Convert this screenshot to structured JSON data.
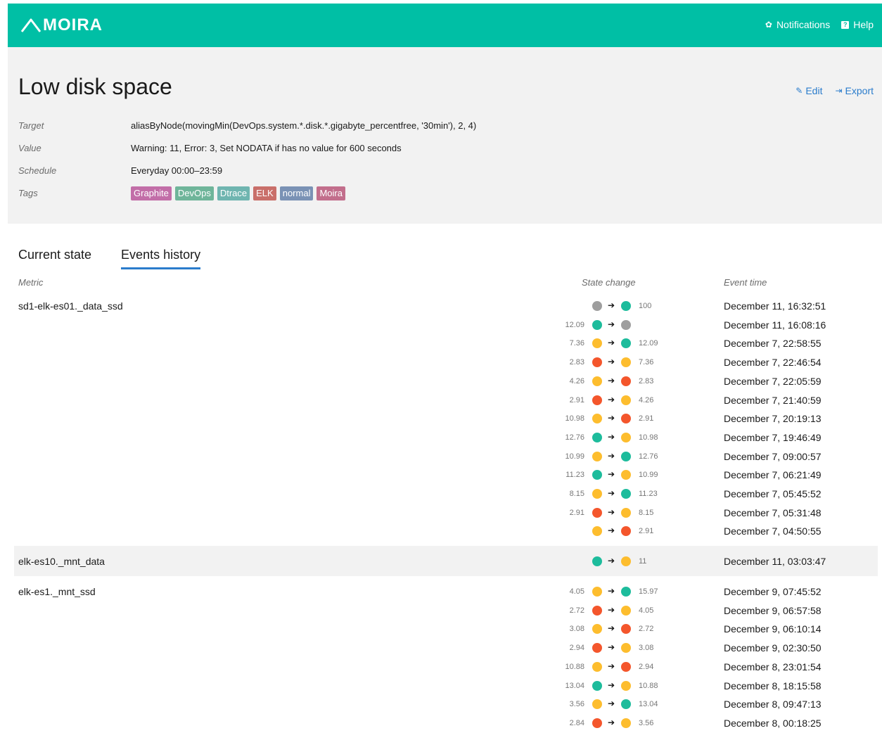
{
  "header": {
    "logo": "MOIRA",
    "nav": [
      {
        "label": "Notifications",
        "icon": "gear-icon"
      },
      {
        "label": "Help",
        "icon": "help-icon"
      }
    ],
    "color": "#00bfa5"
  },
  "trigger": {
    "title": "Low disk space",
    "edit_label": "Edit",
    "export_label": "Export",
    "fields": {
      "target_label": "Target",
      "target_value": "aliasByNode(movingMin(DevOps.system.*.disk.*.gigabyte_percentfree, '30min'), 2, 4)",
      "value_label": "Value",
      "value_value": "Warning: 11, Error: 3, Set NODATA if has no value for 600 seconds",
      "schedule_label": "Schedule",
      "schedule_value": "Everyday 00:00–23:59",
      "tags_label": "Tags"
    },
    "tags": [
      {
        "label": "Graphite",
        "color": "#c26ea8"
      },
      {
        "label": "DevOps",
        "color": "#6fb59a"
      },
      {
        "label": "Dtrace",
        "color": "#6fb5b0"
      },
      {
        "label": "ELK",
        "color": "#c96f6a"
      },
      {
        "label": "normal",
        "color": "#7a92b5"
      },
      {
        "label": "Moira",
        "color": "#c26e8c"
      }
    ]
  },
  "tabs": [
    {
      "label": "Current state",
      "active": false
    },
    {
      "label": "Events history",
      "active": true
    }
  ],
  "columns": {
    "metric": "Metric",
    "state_change": "State change",
    "event_time": "Event time"
  },
  "state_colors": {
    "ok": "#1dbc9c",
    "warn": "#fdbd2e",
    "error": "#f4562c",
    "nodata": "#9e9e9e"
  },
  "groups": [
    {
      "metric": "sd1-elk-es01._data_ssd",
      "shaded": false,
      "events": [
        {
          "from_val": "",
          "from": "nodata",
          "to": "ok",
          "to_val": "100",
          "time": "December 11, 16:32:51"
        },
        {
          "from_val": "12.09",
          "from": "ok",
          "to": "nodata",
          "to_val": "",
          "time": "December 11, 16:08:16"
        },
        {
          "from_val": "7.36",
          "from": "warn",
          "to": "ok",
          "to_val": "12.09",
          "time": "December 7, 22:58:55"
        },
        {
          "from_val": "2.83",
          "from": "error",
          "to": "warn",
          "to_val": "7.36",
          "time": "December 7, 22:46:54"
        },
        {
          "from_val": "4.26",
          "from": "warn",
          "to": "error",
          "to_val": "2.83",
          "time": "December 7, 22:05:59"
        },
        {
          "from_val": "2.91",
          "from": "error",
          "to": "warn",
          "to_val": "4.26",
          "time": "December 7, 21:40:59"
        },
        {
          "from_val": "10.98",
          "from": "warn",
          "to": "error",
          "to_val": "2.91",
          "time": "December 7, 20:19:13"
        },
        {
          "from_val": "12.76",
          "from": "ok",
          "to": "warn",
          "to_val": "10.98",
          "time": "December 7, 19:46:49"
        },
        {
          "from_val": "10.99",
          "from": "warn",
          "to": "ok",
          "to_val": "12.76",
          "time": "December 7, 09:00:57"
        },
        {
          "from_val": "11.23",
          "from": "ok",
          "to": "warn",
          "to_val": "10.99",
          "time": "December 7, 06:21:49"
        },
        {
          "from_val": "8.15",
          "from": "warn",
          "to": "ok",
          "to_val": "11.23",
          "time": "December 7, 05:45:52"
        },
        {
          "from_val": "2.91",
          "from": "error",
          "to": "warn",
          "to_val": "8.15",
          "time": "December 7, 05:31:48"
        },
        {
          "from_val": "",
          "from": "warn",
          "to": "error",
          "to_val": "2.91",
          "time": "December 7, 04:50:55"
        }
      ]
    },
    {
      "metric": "elk-es10._mnt_data",
      "shaded": true,
      "events": [
        {
          "from_val": "",
          "from": "ok",
          "to": "warn",
          "to_val": "11",
          "time": "December 11, 03:03:47"
        }
      ]
    },
    {
      "metric": "elk-es1._mnt_ssd",
      "shaded": false,
      "events": [
        {
          "from_val": "4.05",
          "from": "warn",
          "to": "ok",
          "to_val": "15.97",
          "time": "December 9, 07:45:52"
        },
        {
          "from_val": "2.72",
          "from": "error",
          "to": "warn",
          "to_val": "4.05",
          "time": "December 9, 06:57:58"
        },
        {
          "from_val": "3.08",
          "from": "warn",
          "to": "error",
          "to_val": "2.72",
          "time": "December 9, 06:10:14"
        },
        {
          "from_val": "2.94",
          "from": "error",
          "to": "warn",
          "to_val": "3.08",
          "time": "December 9, 02:30:50"
        },
        {
          "from_val": "10.88",
          "from": "warn",
          "to": "error",
          "to_val": "2.94",
          "time": "December 8, 23:01:54"
        },
        {
          "from_val": "13.04",
          "from": "ok",
          "to": "warn",
          "to_val": "10.88",
          "time": "December 8, 18:15:58"
        },
        {
          "from_val": "3.56",
          "from": "warn",
          "to": "ok",
          "to_val": "13.04",
          "time": "December 8, 09:47:13"
        },
        {
          "from_val": "2.84",
          "from": "error",
          "to": "warn",
          "to_val": "3.56",
          "time": "December 8, 00:18:25"
        }
      ]
    }
  ]
}
